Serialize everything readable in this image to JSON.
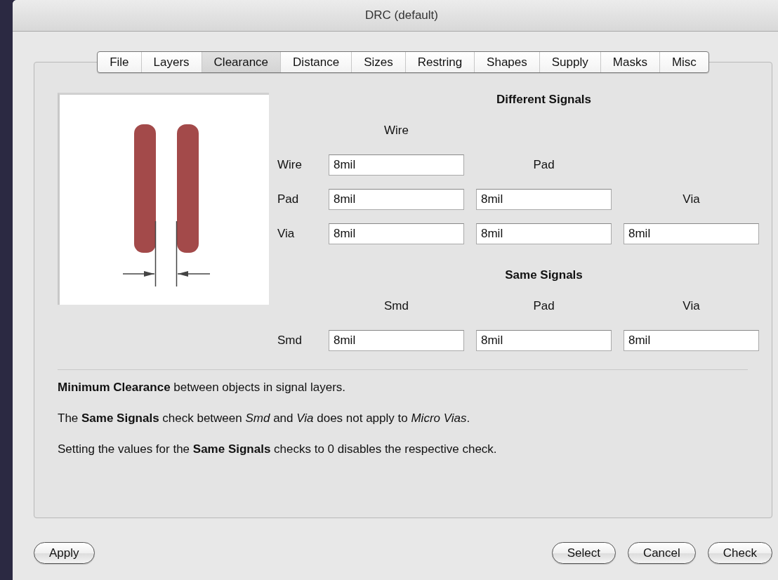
{
  "window": {
    "title": "DRC (default)"
  },
  "tabs": [
    {
      "label": "File",
      "selected": false
    },
    {
      "label": "Layers",
      "selected": false
    },
    {
      "label": "Clearance",
      "selected": true
    },
    {
      "label": "Distance",
      "selected": false
    },
    {
      "label": "Sizes",
      "selected": false
    },
    {
      "label": "Restring",
      "selected": false
    },
    {
      "label": "Shapes",
      "selected": false
    },
    {
      "label": "Supply",
      "selected": false
    },
    {
      "label": "Masks",
      "selected": false
    },
    {
      "label": "Misc",
      "selected": false
    }
  ],
  "different_signals": {
    "kind": "triangle",
    "title": "Different Signals",
    "column_headers": [
      "Wire",
      "Pad",
      "Via"
    ],
    "rows": [
      {
        "label": "Wire",
        "values": [
          "8mil"
        ]
      },
      {
        "label": "Pad",
        "values": [
          "8mil",
          "8mil"
        ]
      },
      {
        "label": "Via",
        "values": [
          "8mil",
          "8mil",
          "8mil"
        ]
      }
    ]
  },
  "same_signals": {
    "kind": "grid",
    "title": "Same Signals",
    "column_headers": [
      "Smd",
      "Pad",
      "Via"
    ],
    "rows": [
      {
        "label": "Smd",
        "values": [
          "8mil",
          "8mil",
          "8mil"
        ]
      }
    ]
  },
  "notes": [
    "**Minimum Clearance** between objects in signal layers.",
    "The **Same Signals** check between *Smd* and *Via* does not apply to *Micro Vias*.",
    "Setting the values for the **Same Signals** checks to 0 disables the respective check."
  ],
  "buttons_left": [
    "Apply"
  ],
  "buttons_right": [
    "Select",
    "Cancel",
    "Check"
  ]
}
